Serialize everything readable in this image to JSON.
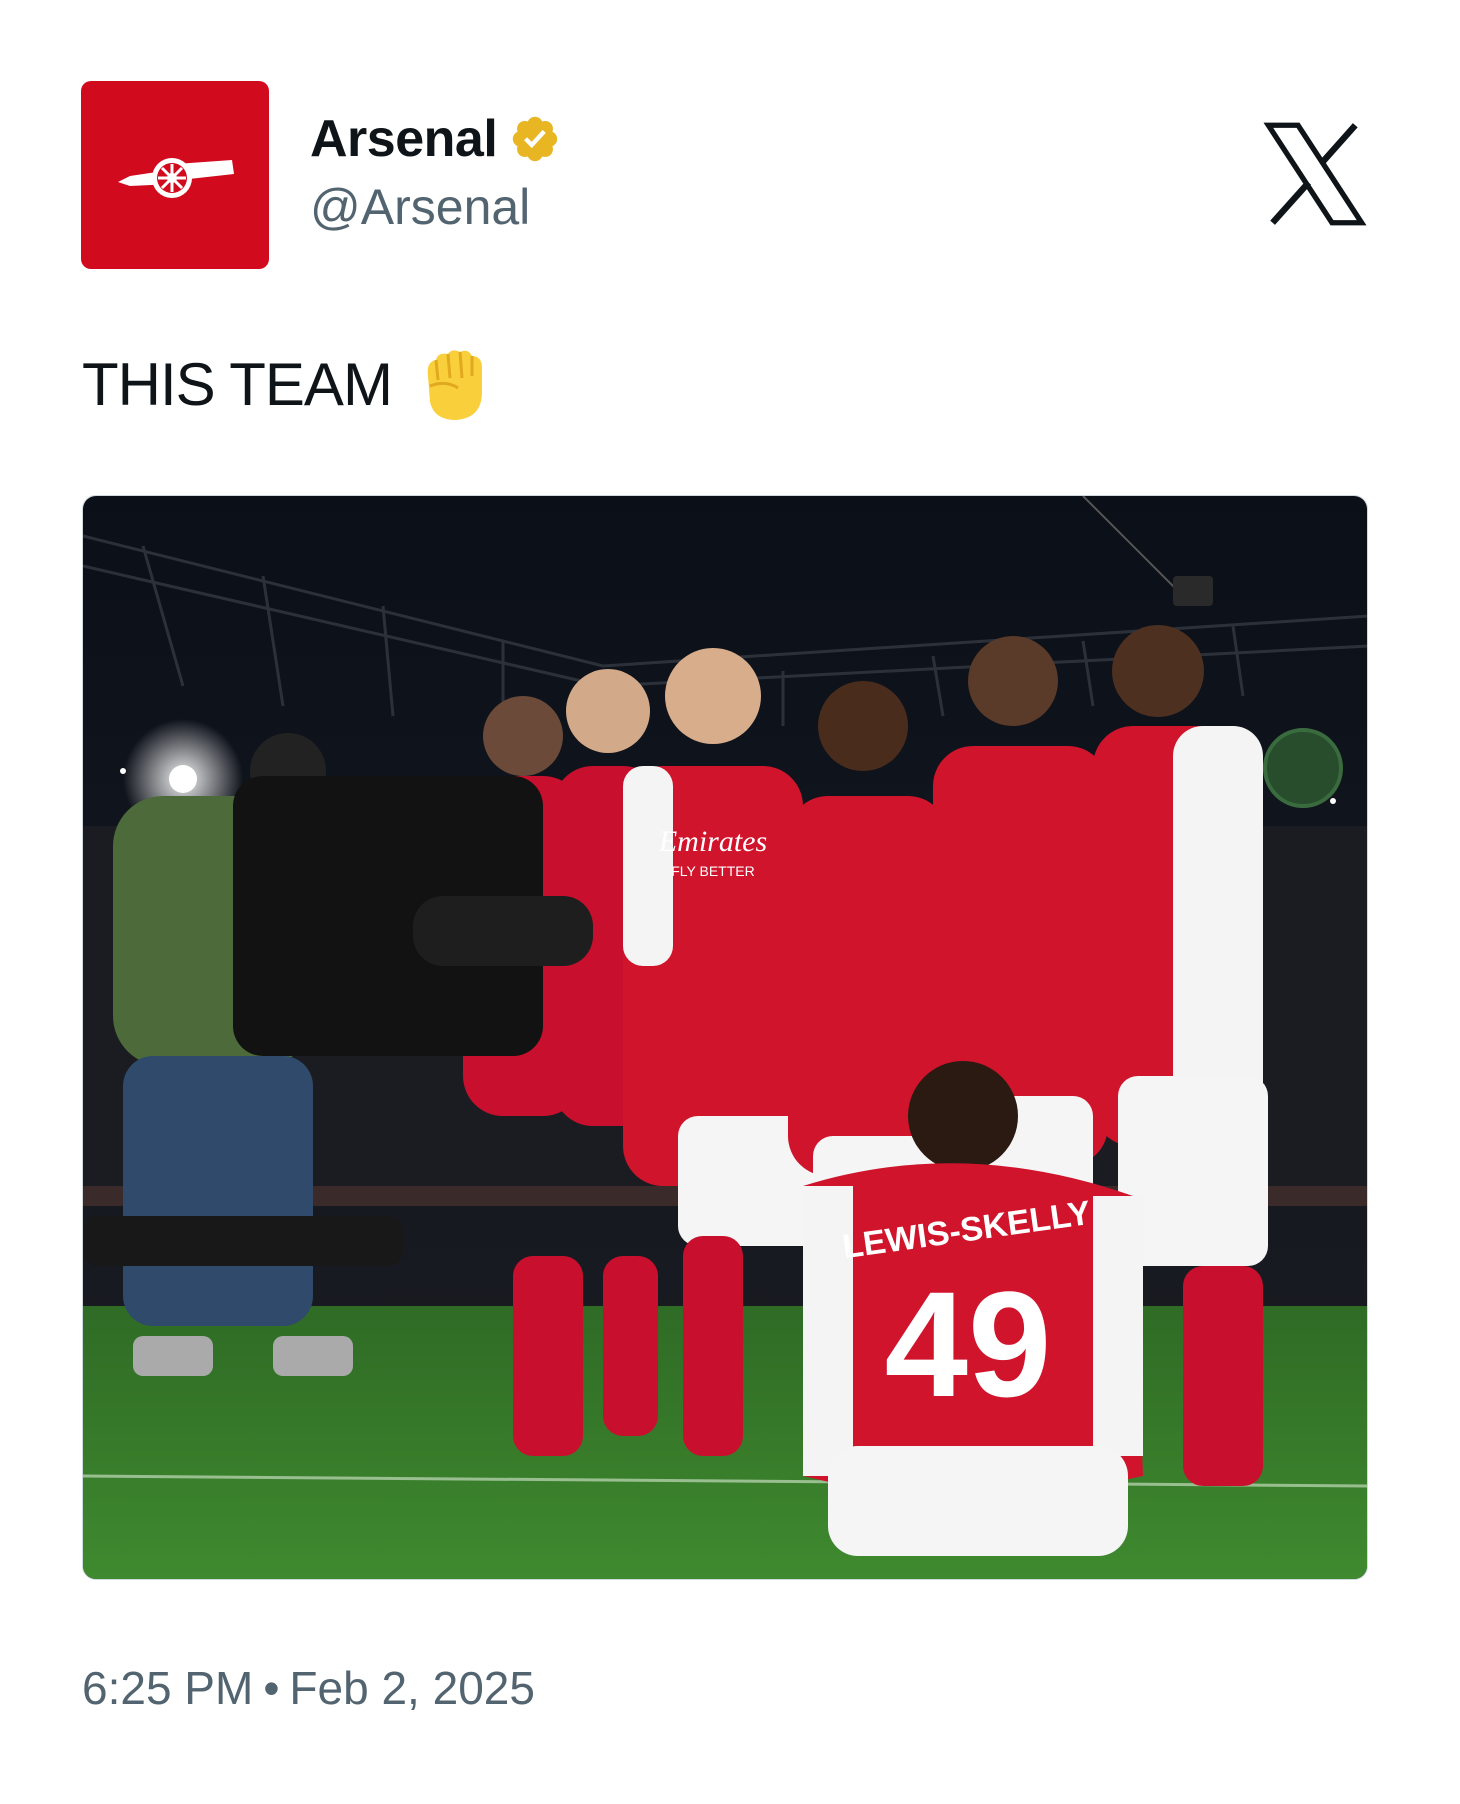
{
  "post": {
    "author": {
      "display_name": "Arsenal",
      "handle": "@Arsenal",
      "verified": true,
      "verified_badge_color": "#e8b523",
      "avatar_icon": "arsenal-cannon-icon",
      "avatar_color": "#d20a1e"
    },
    "platform_icon": "x-logo-icon",
    "text": "THIS TEAM",
    "text_emoji": "raised-fist-emoji",
    "media": {
      "kind": "photo",
      "shirt_name": "LEWIS-SKELLY",
      "shirt_number": "49",
      "sponsor": "Emirates",
      "sponsor_tagline": "FLY BETTER"
    },
    "time": "6:25 PM",
    "separator": "•",
    "date": "Feb 2, 2025"
  }
}
